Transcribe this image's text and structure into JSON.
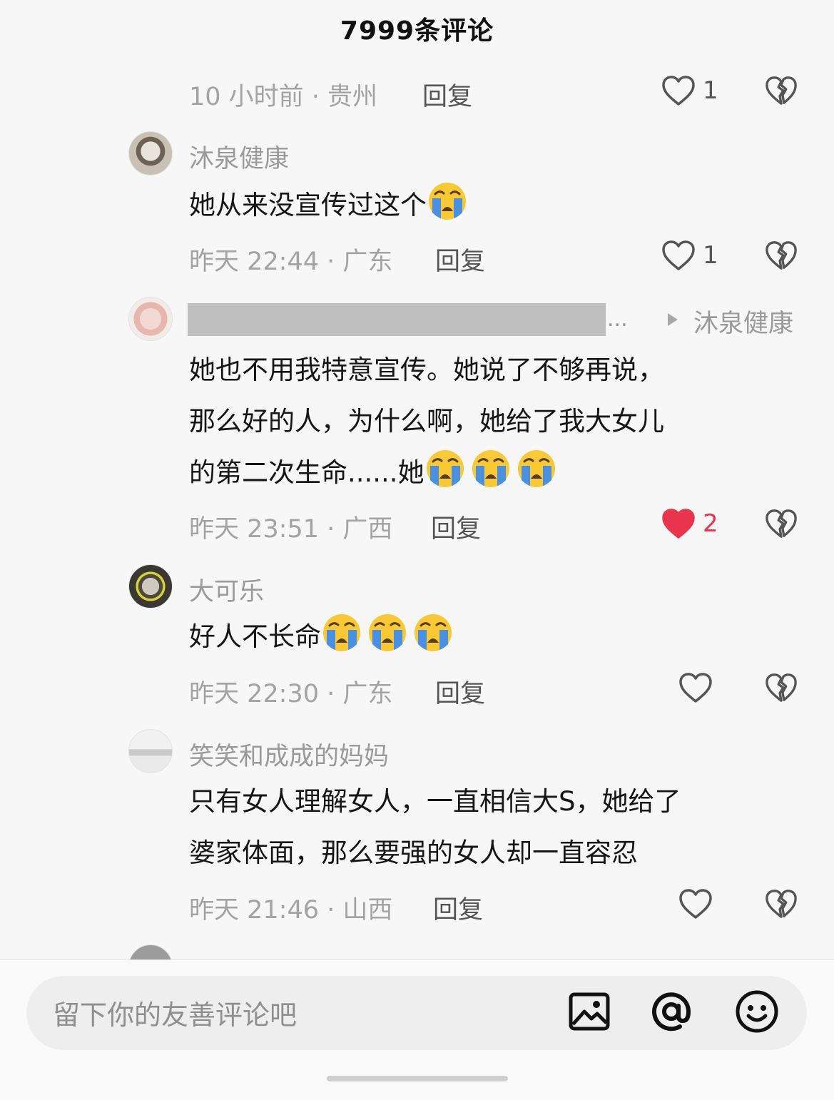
{
  "header": {
    "title": "7999条评论"
  },
  "comments": [
    {
      "meta": "10 小时前 · 贵州",
      "reply": "回复",
      "likes": "1",
      "liked": false
    },
    {
      "user": "沐泉健康",
      "text": "她从来没宣传过这个",
      "meta": "昨天 22:44 · 广东",
      "reply": "回复",
      "likes": "1",
      "liked": false,
      "emojis": 1
    },
    {
      "user": "",
      "reply_to": "沐泉健康",
      "lines": [
        "她也不用我特意宣传。她说了不够再说，",
        "那么好的人，为什么啊，她给了我大女儿",
        "的第二次生命......她"
      ],
      "meta": "昨天 23:51 · 广西",
      "reply": "回复",
      "likes": "2",
      "liked": true,
      "emojis": 3
    },
    {
      "user": "大可乐",
      "text": "好人不长命",
      "meta": "昨天 22:30 · 广东",
      "reply": "回复",
      "likes": "",
      "liked": false,
      "emojis": 3
    },
    {
      "user": "笑笑和成成的妈妈",
      "lines": [
        "只有女人理解女人，一直相信大S，她给了",
        "婆家体面，那么要强的女人却一直容忍"
      ],
      "meta": "昨天 21:46 · 山西",
      "reply": "回复",
      "likes": "",
      "liked": false
    }
  ],
  "composer": {
    "placeholder": "留下你的友善评论吧"
  },
  "icons": {
    "like": "heart-outline-icon",
    "liked": "heart-filled-icon",
    "dislike": "broken-heart-icon",
    "image": "image-icon",
    "mention": "at-icon",
    "emoji": "smile-icon",
    "crying": "crying-face-emoji"
  },
  "colors": {
    "liked": "#e8344d",
    "emoji": "#f9c935",
    "tears": "#4a90e2"
  }
}
